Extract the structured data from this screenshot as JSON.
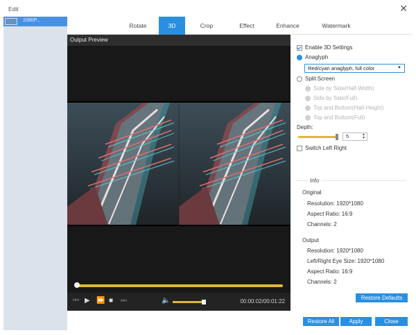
{
  "window": {
    "title": "Edit",
    "close_glyph": "✕"
  },
  "file_list": {
    "items": [
      {
        "name": "1080P..."
      }
    ]
  },
  "tabs": [
    {
      "label": "Rotate",
      "active": false
    },
    {
      "label": "3D",
      "active": true
    },
    {
      "label": "Crop",
      "active": false
    },
    {
      "label": "Effect",
      "active": false
    },
    {
      "label": "Enhance",
      "active": false
    },
    {
      "label": "Watermark",
      "active": false
    }
  ],
  "preview": {
    "label": "Output Preview",
    "timecode": "00:00:02/00:01:22",
    "progress": 0.0,
    "volume": 0.9
  },
  "settings": {
    "enable_label": "Enable 3D Settings",
    "enable_checked": true,
    "anaglyph_label": "Anaglyph",
    "anaglyph_selected": "Red/cyan anaglyph, full color",
    "split_label": "Split Screen",
    "split_options": [
      "Side by Side(Half-Width)",
      "Side by Side(Full)",
      "Top and Bottom(Half-Height)",
      "Top and Bottom(Full)"
    ],
    "depth_label": "Depth:",
    "depth_value": "5",
    "switch_label": "Switch Left Right"
  },
  "info": {
    "title": "Info",
    "original_label": "Original",
    "original": [
      "Resolution: 1920*1080",
      "Aspect Ratio: 16:9",
      "Channels: 2"
    ],
    "output_label": "Output",
    "output": [
      "Resolution: 1920*1080",
      "Left/Right Eye Size: 1920*1080",
      "Aspect Ratio: 16:9",
      "Channels: 2"
    ]
  },
  "buttons": {
    "restore_defaults": "Restore Defaults",
    "restore_all": "Restore All",
    "apply": "Apply",
    "close": "Close"
  },
  "colors": {
    "accent": "#2b8fe0",
    "slider": "#e0b838",
    "panel": "#dbe2ec",
    "preview_bg": "#181818"
  },
  "icons": {
    "prev": "skip-back-icon",
    "play": "play-icon",
    "ff": "fast-forward-icon",
    "stop": "stop-icon",
    "next": "skip-forward-icon",
    "volume": "volume-icon"
  }
}
